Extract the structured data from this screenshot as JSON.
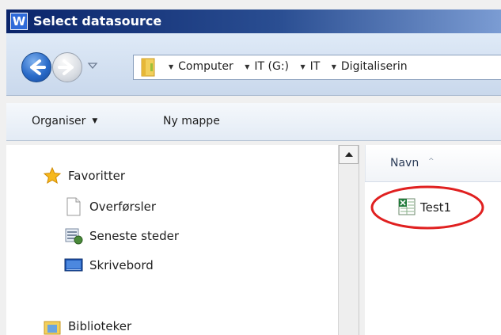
{
  "window": {
    "title": "Select datasource",
    "app_icon_letter": "W"
  },
  "address_bar": {
    "crumbs": [
      "Computer",
      "IT (G:)",
      "IT",
      "Digitaliserin"
    ]
  },
  "toolbar": {
    "organise_label": "Organiser",
    "new_folder_label": "Ny mappe"
  },
  "nav_pane": {
    "favorites_label": "Favoritter",
    "items": [
      "Overførsler",
      "Seneste steder",
      "Skrivebord"
    ],
    "libraries_label": "Biblioteker"
  },
  "file_list": {
    "column_name": "Navn",
    "sort_indicator": "^",
    "files": [
      {
        "name": "Test1",
        "type": "excel-file-icon"
      }
    ]
  },
  "colors": {
    "title_bar_start": "#0a246a",
    "title_bar_end": "#7b9cd3",
    "highlight_ring": "#e02020",
    "excel_green": "#1f7a3a"
  }
}
